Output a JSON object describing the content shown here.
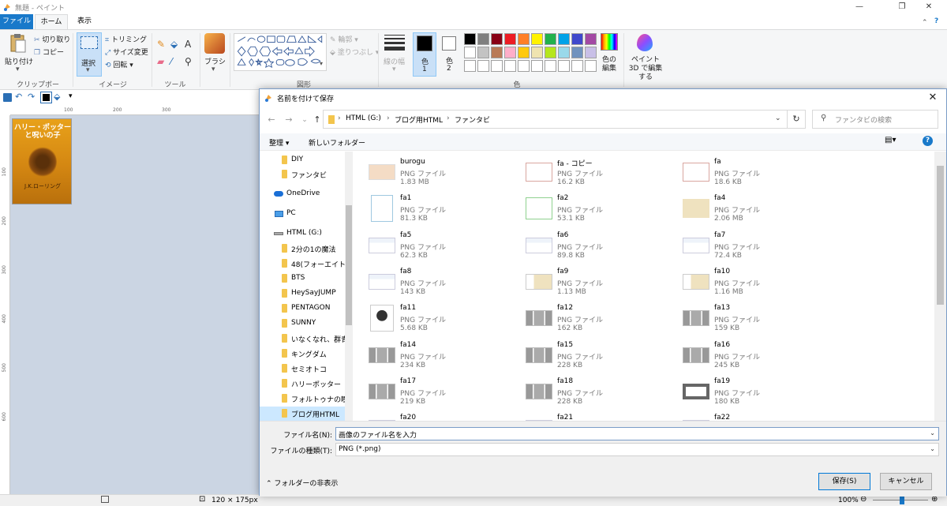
{
  "window": {
    "title": "無題 - ペイント",
    "minimize": "—",
    "maximize": "❐",
    "close": "✕"
  },
  "ribbon": {
    "tabs": [
      "ファイル",
      "ホーム",
      "表示"
    ],
    "clipboard": {
      "paste": "貼り付け",
      "cut": "切り取り",
      "copy": "コピー",
      "group": "クリップボード"
    },
    "image": {
      "select": "選択",
      "crop": "トリミング",
      "resize": "サイズ変更",
      "rotate": "回転",
      "group": "イメージ"
    },
    "tools": {
      "group": "ツール"
    },
    "brush": {
      "label": "ブラシ"
    },
    "shapes": {
      "outline": "輪郭",
      "fill": "塗りつぶし",
      "group": "図形"
    },
    "size": {
      "label": "線の幅"
    },
    "color1": {
      "label": "色",
      "number": "1"
    },
    "color2": {
      "label": "色",
      "number": "2"
    },
    "colors": {
      "group": "色",
      "edit": "色の編集",
      "row1": [
        "#000000",
        "#7f7f7f",
        "#880015",
        "#ed1c24",
        "#ff7f27",
        "#fff200",
        "#22b14c",
        "#00a2e8",
        "#3f48cc",
        "#a349a4"
      ],
      "row2": [
        "#ffffff",
        "#c3c3c3",
        "#b97a57",
        "#ffaec9",
        "#ffc90e",
        "#efe4b0",
        "#b5e61d",
        "#99d9ea",
        "#7092be",
        "#c8bfe7"
      ]
    },
    "paint3d": "ペイント 3D で編集する"
  },
  "rulers": {
    "h": [
      "100",
      "200",
      "300"
    ],
    "v": [
      "100",
      "200",
      "300",
      "400",
      "500",
      "600"
    ]
  },
  "canvas": {
    "book_title": "ハリー・ポッターと呪いの子",
    "book_author": "J.K.ローリング"
  },
  "status": {
    "dimensions": "120 × 175px",
    "zoom": "100%"
  },
  "dialog": {
    "title": "名前を付けて保存",
    "breadcrumb": [
      "HTML (G:)",
      "ブログ用HTML",
      "ファンタビ"
    ],
    "search_placeholder": "ファンタビの検索",
    "organize": "整理 ▾",
    "new_folder": "新しいフォルダー",
    "help": "?",
    "nav": [
      {
        "label": "DIY",
        "kind": "folder",
        "indent": 1
      },
      {
        "label": "ファンタビ",
        "kind": "folder",
        "indent": 1
      },
      {
        "label": "OneDrive",
        "kind": "cloud",
        "indent": 0
      },
      {
        "label": "PC",
        "kind": "pc",
        "indent": 0
      },
      {
        "label": "HTML (G:)",
        "kind": "drive",
        "indent": 0
      },
      {
        "label": "2分の1の魔法",
        "kind": "folder",
        "indent": 1
      },
      {
        "label": "48(フォーエイト)",
        "kind": "folder",
        "indent": 1
      },
      {
        "label": "BTS",
        "kind": "folder",
        "indent": 1
      },
      {
        "label": "HeySayJUMP",
        "kind": "folder",
        "indent": 1
      },
      {
        "label": "PENTAGON",
        "kind": "folder",
        "indent": 1
      },
      {
        "label": "SUNNY",
        "kind": "folder",
        "indent": 1
      },
      {
        "label": "いなくなれ、群青",
        "kind": "folder",
        "indent": 1
      },
      {
        "label": "キングダム",
        "kind": "folder",
        "indent": 1
      },
      {
        "label": "セミオトコ",
        "kind": "folder",
        "indent": 1
      },
      {
        "label": "ハリーポッター",
        "kind": "folder",
        "indent": 1
      },
      {
        "label": "フォルトゥナの瞳",
        "kind": "folder",
        "indent": 1
      },
      {
        "label": "ブログ用HTML",
        "kind": "folder",
        "indent": 1,
        "selected": true
      }
    ],
    "files": [
      {
        "name": "burogu",
        "type": "PNG ファイル",
        "size": "1.83 MB",
        "thumb": "peach"
      },
      {
        "name": "fa - コピー",
        "type": "PNG ファイル",
        "size": "16.2 KB",
        "thumb": "frame-red"
      },
      {
        "name": "fa",
        "type": "PNG ファイル",
        "size": "18.6 KB",
        "thumb": "frame-red"
      },
      {
        "name": "fa1",
        "type": "PNG ファイル",
        "size": "81.3 KB",
        "thumb": "frame-blue"
      },
      {
        "name": "fa2",
        "type": "PNG ファイル",
        "size": "53.1 KB",
        "thumb": "frame-green"
      },
      {
        "name": "fa4",
        "type": "PNG ファイル",
        "size": "2.06 MB",
        "thumb": "beige"
      },
      {
        "name": "fa5",
        "type": "PNG ファイル",
        "size": "62.3 KB",
        "thumb": "screen"
      },
      {
        "name": "fa6",
        "type": "PNG ファイル",
        "size": "89.8 KB",
        "thumb": "screen"
      },
      {
        "name": "fa7",
        "type": "PNG ファイル",
        "size": "72.4 KB",
        "thumb": "screen"
      },
      {
        "name": "fa8",
        "type": "PNG ファイル",
        "size": "143 KB",
        "thumb": "screen"
      },
      {
        "name": "fa9",
        "type": "PNG ファイル",
        "size": "1.13 MB",
        "thumb": "screen-beige"
      },
      {
        "name": "fa10",
        "type": "PNG ファイル",
        "size": "1.16 MB",
        "thumb": "screen-beige"
      },
      {
        "name": "fa11",
        "type": "PNG ファイル",
        "size": "5.68 KB",
        "thumb": "avatar"
      },
      {
        "name": "fa12",
        "type": "PNG ファイル",
        "size": "162 KB",
        "thumb": "gray"
      },
      {
        "name": "fa13",
        "type": "PNG ファイル",
        "size": "159 KB",
        "thumb": "gray"
      },
      {
        "name": "fa14",
        "type": "PNG ファイル",
        "size": "234 KB",
        "thumb": "gray"
      },
      {
        "name": "fa15",
        "type": "PNG ファイル",
        "size": "228 KB",
        "thumb": "gray"
      },
      {
        "name": "fa16",
        "type": "PNG ファイル",
        "size": "245 KB",
        "thumb": "gray"
      },
      {
        "name": "fa17",
        "type": "PNG ファイル",
        "size": "219 KB",
        "thumb": "gray"
      },
      {
        "name": "fa18",
        "type": "PNG ファイル",
        "size": "228 KB",
        "thumb": "gray"
      },
      {
        "name": "fa19",
        "type": "PNG ファイル",
        "size": "180 KB",
        "thumb": "gray-box"
      },
      {
        "name": "fa20",
        "type": "",
        "size": "",
        "thumb": "screen"
      },
      {
        "name": "fa21",
        "type": "",
        "size": "",
        "thumb": "screen"
      },
      {
        "name": "fa22",
        "type": "",
        "size": "",
        "thumb": "screen"
      }
    ],
    "filename_label": "ファイル名(N):",
    "filename_value": "画像のファイル名を入力",
    "filetype_label": "ファイルの種類(T):",
    "filetype_value": "PNG (*.png)",
    "hide_folders": "フォルダーの非表示",
    "save": "保存(S)",
    "cancel": "キャンセル"
  }
}
